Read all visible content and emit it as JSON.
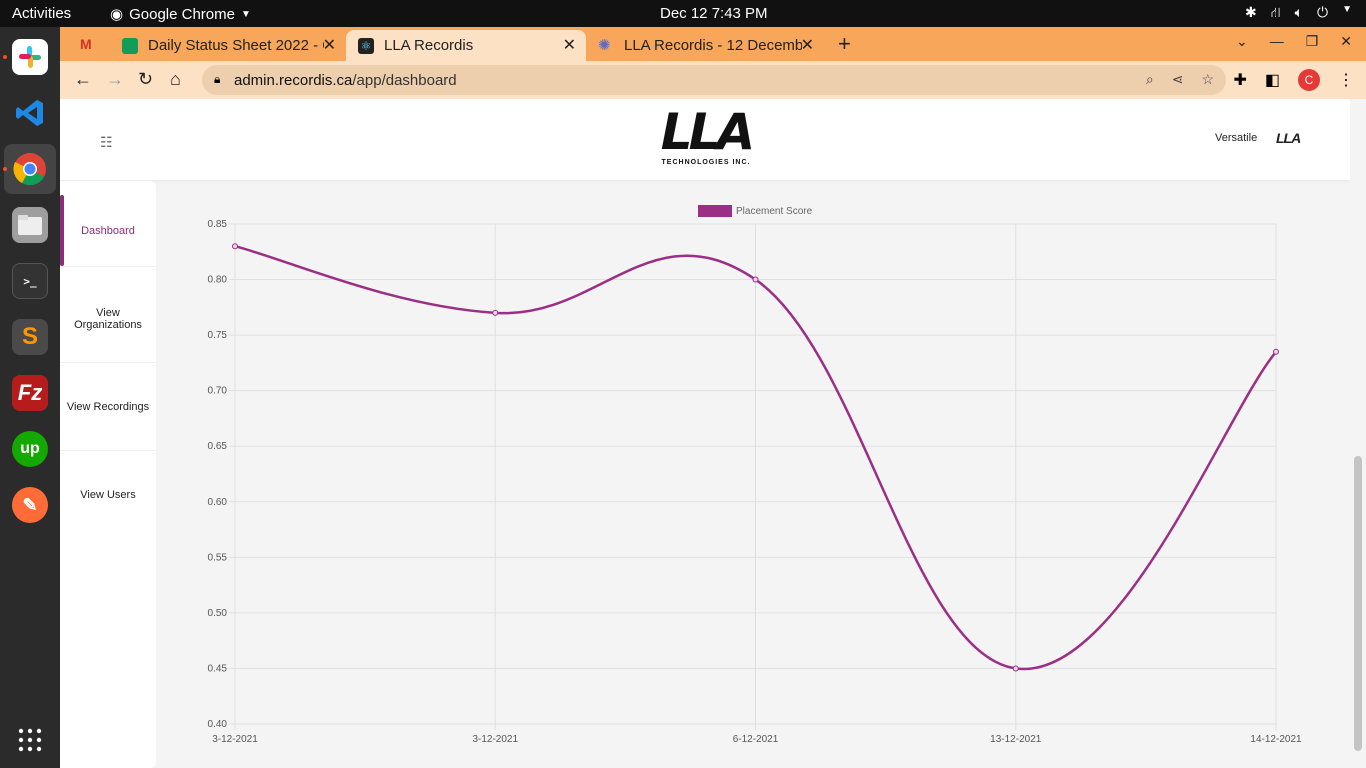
{
  "system": {
    "activities": "Activities",
    "app_name": "Google Chrome",
    "clock": "Dec 12  7:43 PM"
  },
  "browser": {
    "tabs": [
      {
        "title": "Daily Status Sheet 2022 - G",
        "icon": "sheets-icon"
      },
      {
        "title": "LLA Recordis",
        "icon": "react-icon"
      },
      {
        "title": "LLA Recordis - 12 Decemb",
        "icon": "gear-flower-icon"
      }
    ],
    "url_host": "admin.recordis.ca",
    "url_path": "/app/dashboard",
    "profile_initial": "C",
    "colors": {
      "tabbar": "#f8a75a",
      "toolbar": "#fde1c4"
    }
  },
  "app": {
    "logo_text": "LLA",
    "logo_sub": "TECHNOLOGIES INC.",
    "user_name": "Versatile",
    "user_logo": "LLA",
    "sidebar": [
      {
        "label": "Dashboard",
        "active": true
      },
      {
        "label": "View Organizations",
        "active": false
      },
      {
        "label": "View Recordings",
        "active": false
      },
      {
        "label": "View Users",
        "active": false
      }
    ],
    "accent": "#8b2d7a"
  },
  "chart_data": {
    "type": "line",
    "categories": [
      "3-12-2021",
      "3-12-2021",
      "6-12-2021",
      "13-12-2021",
      "14-12-2021"
    ],
    "series": [
      {
        "name": "Placement Score",
        "values": [
          0.83,
          0.77,
          0.8,
          0.45,
          0.735
        ],
        "color": "#9b2f86"
      }
    ],
    "ylim": [
      0.4,
      0.85
    ],
    "yticks": [
      "0.85",
      "0.80",
      "0.75",
      "0.70",
      "0.65",
      "0.60",
      "0.55",
      "0.50",
      "0.45",
      "0.40"
    ],
    "grid": true,
    "legend": "top-center",
    "smooth": true
  }
}
